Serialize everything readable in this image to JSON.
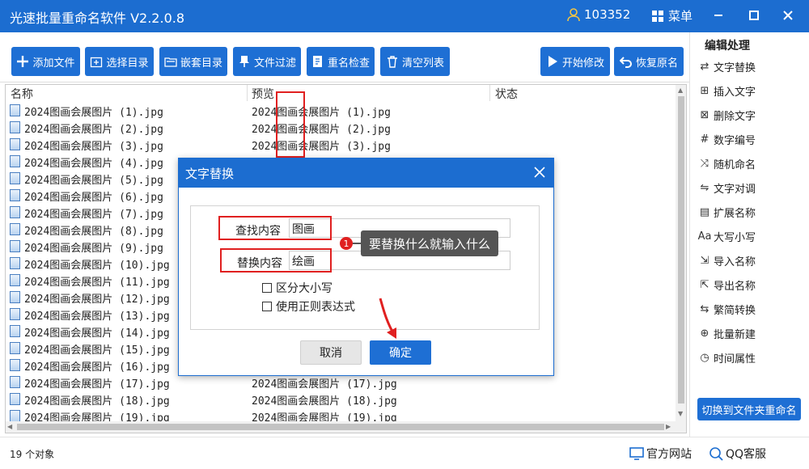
{
  "app": {
    "title": "光速批量重命名软件 V2.2.0.8",
    "user_id": "103352",
    "menu_label": "菜单"
  },
  "toolbar": {
    "buttons": [
      {
        "label": "添加文件",
        "icon": "plus-icon"
      },
      {
        "label": "选择目录",
        "icon": "folder-plus-icon"
      },
      {
        "label": "嵌套目录",
        "icon": "folder-tree-icon"
      },
      {
        "label": "文件过滤",
        "icon": "filter-icon"
      },
      {
        "label": "重名检查",
        "icon": "check-doc-icon"
      },
      {
        "label": "清空列表",
        "icon": "trash-icon"
      },
      {
        "label": "开始修改",
        "icon": "play-icon"
      },
      {
        "label": "恢复原名",
        "icon": "undo-icon"
      }
    ]
  },
  "file_list": {
    "columns": [
      "名称",
      "预览",
      "状态"
    ],
    "rows": [
      {
        "name": "2024图画会展图片 (1).jpg",
        "preview": "2024图画会展图片 (1).jpg"
      },
      {
        "name": "2024图画会展图片 (2).jpg",
        "preview": "2024图画会展图片 (2).jpg"
      },
      {
        "name": "2024图画会展图片 (3).jpg",
        "preview": "2024图画会展图片 (3).jpg"
      },
      {
        "name": "2024图画会展图片 (4).jpg",
        "preview": ""
      },
      {
        "name": "2024图画会展图片 (5).jpg",
        "preview": ""
      },
      {
        "name": "2024图画会展图片 (6).jpg",
        "preview": ""
      },
      {
        "name": "2024图画会展图片 (7).jpg",
        "preview": ""
      },
      {
        "name": "2024图画会展图片 (8).jpg",
        "preview": ""
      },
      {
        "name": "2024图画会展图片 (9).jpg",
        "preview": ""
      },
      {
        "name": "2024图画会展图片 (10).jpg",
        "preview": ""
      },
      {
        "name": "2024图画会展图片 (11).jpg",
        "preview": ""
      },
      {
        "name": "2024图画会展图片 (12).jpg",
        "preview": ""
      },
      {
        "name": "2024图画会展图片 (13).jpg",
        "preview": ""
      },
      {
        "name": "2024图画会展图片 (14).jpg",
        "preview": ""
      },
      {
        "name": "2024图画会展图片 (15).jpg",
        "preview": ""
      },
      {
        "name": "2024图画会展图片 (16).jpg",
        "preview": ""
      },
      {
        "name": "2024图画会展图片 (17).jpg",
        "preview": "2024图画会展图片 (17).jpg"
      },
      {
        "name": "2024图画会展图片 (18).jpg",
        "preview": "2024图画会展图片 (18).jpg"
      },
      {
        "name": "2024图画会展图片 (19).jpg",
        "preview": "2024图画会展图片 (19).jpg"
      }
    ]
  },
  "status": {
    "count": "19 个对象",
    "site_link": "官方网站",
    "qq_link": "QQ客服"
  },
  "sidebar": {
    "title": "编辑处理",
    "items": [
      "文字替换",
      "插入文字",
      "删除文字",
      "数字编号",
      "随机命名",
      "文字对调",
      "扩展名称",
      "大写小写",
      "导入名称",
      "导出名称",
      "繁简转换",
      "批量新建",
      "时间属性"
    ],
    "switch_label": "切换到文件夹重命名"
  },
  "dialog": {
    "title": "文字替换",
    "find_label": "查找内容",
    "find_value": "图画",
    "replace_label": "替换内容",
    "replace_value": "绘画",
    "option_case": "区分大小写",
    "option_regex": "使用正则表达式",
    "cancel_label": "取消",
    "ok_label": "确定"
  },
  "annotation": {
    "badge": "1",
    "tip": "要替换什么就输入什么"
  },
  "colors": {
    "brand": "#1c6dd0",
    "button": "#1e6fd4",
    "highlight": "#e02020"
  }
}
